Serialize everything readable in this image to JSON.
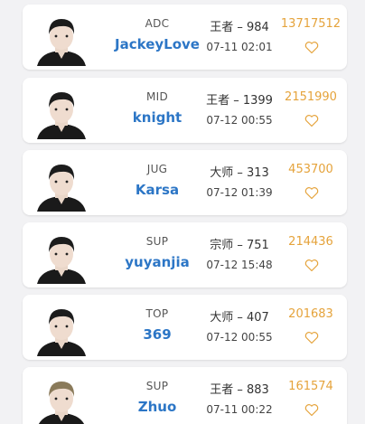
{
  "colors": {
    "background": "#f2f2f4",
    "card": "#ffffff",
    "name": "#2c76c6",
    "score": "#e5a33b",
    "heart": "#e5a33b"
  },
  "players": [
    {
      "role": "ADC",
      "name": "JackeyLove",
      "rank": "王者 – 984",
      "time": "07-11 02:01",
      "score": "13717512",
      "icon": "heart-outline-icon"
    },
    {
      "role": "MID",
      "name": "knight",
      "rank": "王者 – 1399",
      "time": "07-12 00:55",
      "score": "2151990",
      "icon": "heart-outline-icon"
    },
    {
      "role": "JUG",
      "name": "Karsa",
      "rank": "大师 – 313",
      "time": "07-12 01:39",
      "score": "453700",
      "icon": "heart-outline-icon"
    },
    {
      "role": "SUP",
      "name": "yuyanjia",
      "rank": "宗师 – 751",
      "time": "07-12 15:48",
      "score": "214436",
      "icon": "heart-outline-icon"
    },
    {
      "role": "TOP",
      "name": "369",
      "rank": "大师 – 407",
      "time": "07-12 00:55",
      "score": "201683",
      "icon": "heart-outline-icon"
    },
    {
      "role": "SUP",
      "name": "Zhuo",
      "rank": "王者 – 883",
      "time": "07-11 00:22",
      "score": "161574",
      "icon": "heart-outline-icon"
    }
  ]
}
